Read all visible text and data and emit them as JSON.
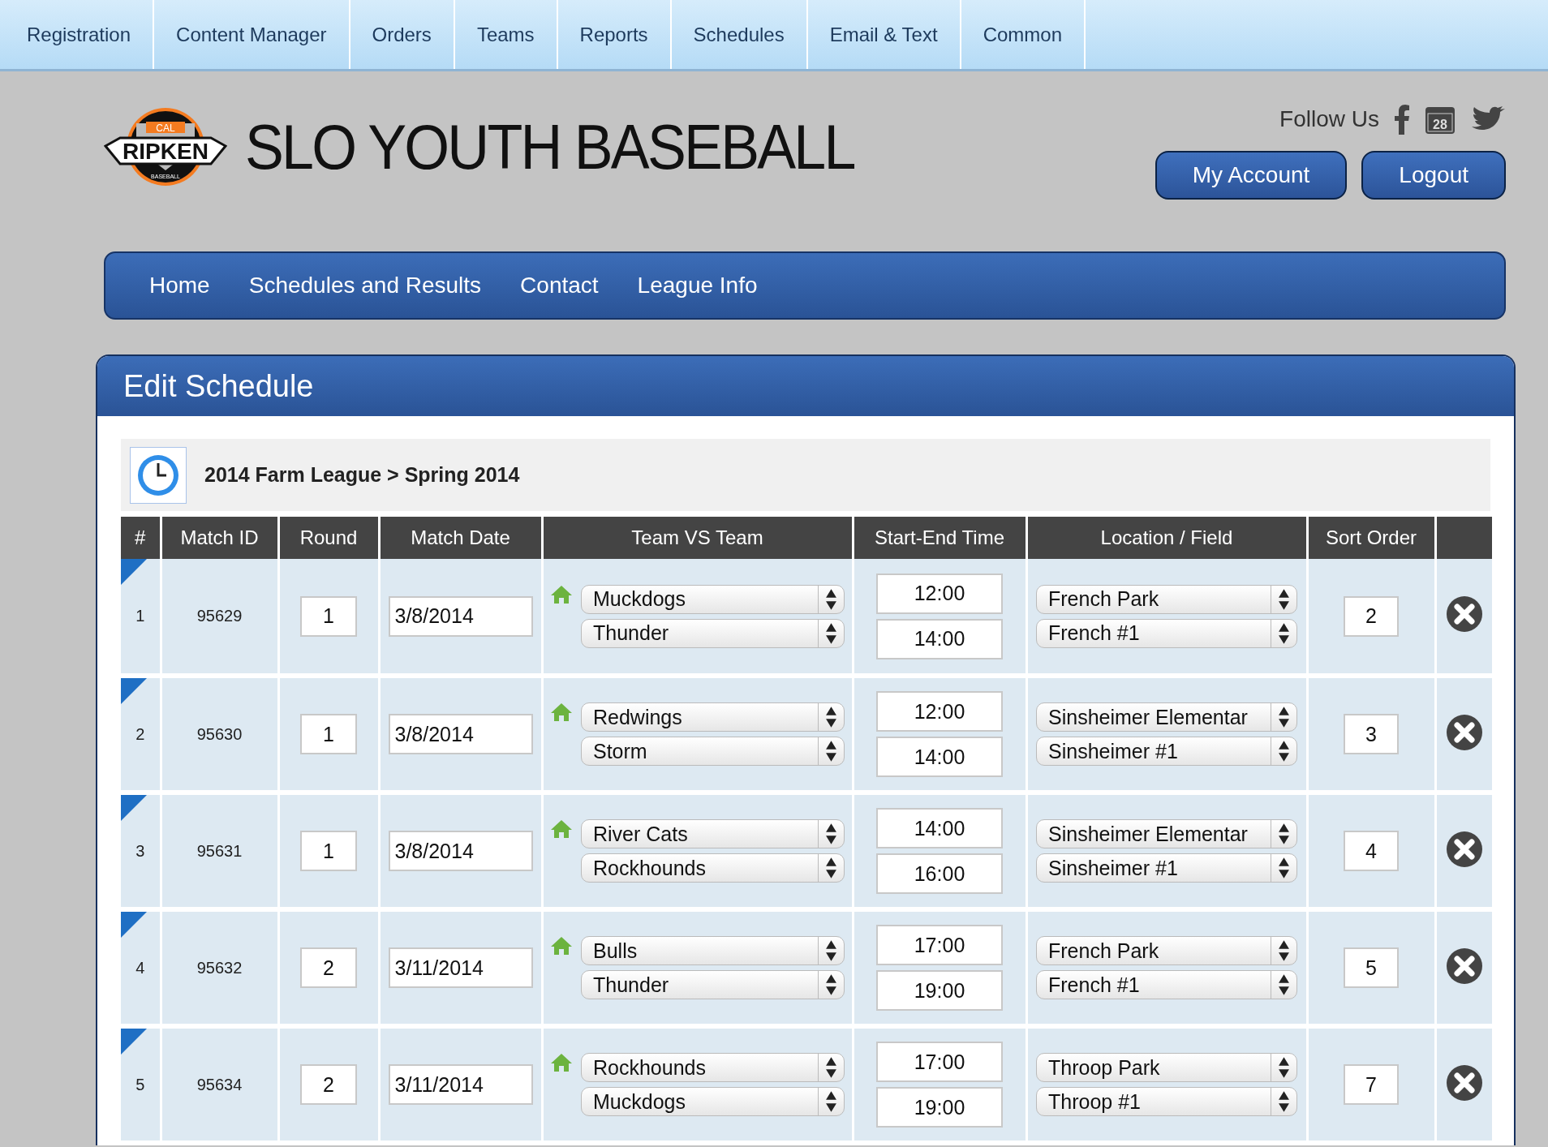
{
  "top_menu": [
    "Registration",
    "Content Manager",
    "Orders",
    "Teams",
    "Reports",
    "Schedules",
    "Email & Text",
    "Common"
  ],
  "header": {
    "logo": {
      "top": "CAL",
      "word": "RIPKEN",
      "bottom": "BASEBALL"
    },
    "title": "SLO YOUTH BASEBALL",
    "follow_label": "Follow Us",
    "calendar_day": "28",
    "buttons": [
      "My Account",
      "Logout"
    ]
  },
  "main_nav": [
    "Home",
    "Schedules and Results",
    "Contact",
    "League Info"
  ],
  "panel": {
    "title": "Edit Schedule",
    "breadcrumb": "2014 Farm League > Spring 2014",
    "columns": [
      "#",
      "Match ID",
      "Round",
      "Match Date",
      "Team VS Team",
      "Start-End Time",
      "Location / Field",
      "Sort Order"
    ],
    "rows": [
      {
        "number": "1",
        "match_id": "95629",
        "round": "1",
        "date": "3/8/2014",
        "home_team": "Muckdogs",
        "away_team": "Thunder",
        "start": "12:00",
        "end": "14:00",
        "location": "French Park",
        "field": "French #1",
        "sort_order": "2"
      },
      {
        "number": "2",
        "match_id": "95630",
        "round": "1",
        "date": "3/8/2014",
        "home_team": "Redwings",
        "away_team": "Storm",
        "start": "12:00",
        "end": "14:00",
        "location": "Sinsheimer Elementar",
        "field": "Sinsheimer #1",
        "sort_order": "3"
      },
      {
        "number": "3",
        "match_id": "95631",
        "round": "1",
        "date": "3/8/2014",
        "home_team": "River Cats",
        "away_team": "Rockhounds",
        "start": "14:00",
        "end": "16:00",
        "location": "Sinsheimer Elementar",
        "field": "Sinsheimer #1",
        "sort_order": "4"
      },
      {
        "number": "4",
        "match_id": "95632",
        "round": "2",
        "date": "3/11/2014",
        "home_team": "Bulls",
        "away_team": "Thunder",
        "start": "17:00",
        "end": "19:00",
        "location": "French Park",
        "field": "French #1",
        "sort_order": "5"
      },
      {
        "number": "5",
        "match_id": "95634",
        "round": "2",
        "date": "3/11/2014",
        "home_team": "Rockhounds",
        "away_team": "Muckdogs",
        "start": "17:00",
        "end": "19:00",
        "location": "Throop Park",
        "field": "Throop #1",
        "sort_order": "7"
      }
    ]
  }
}
